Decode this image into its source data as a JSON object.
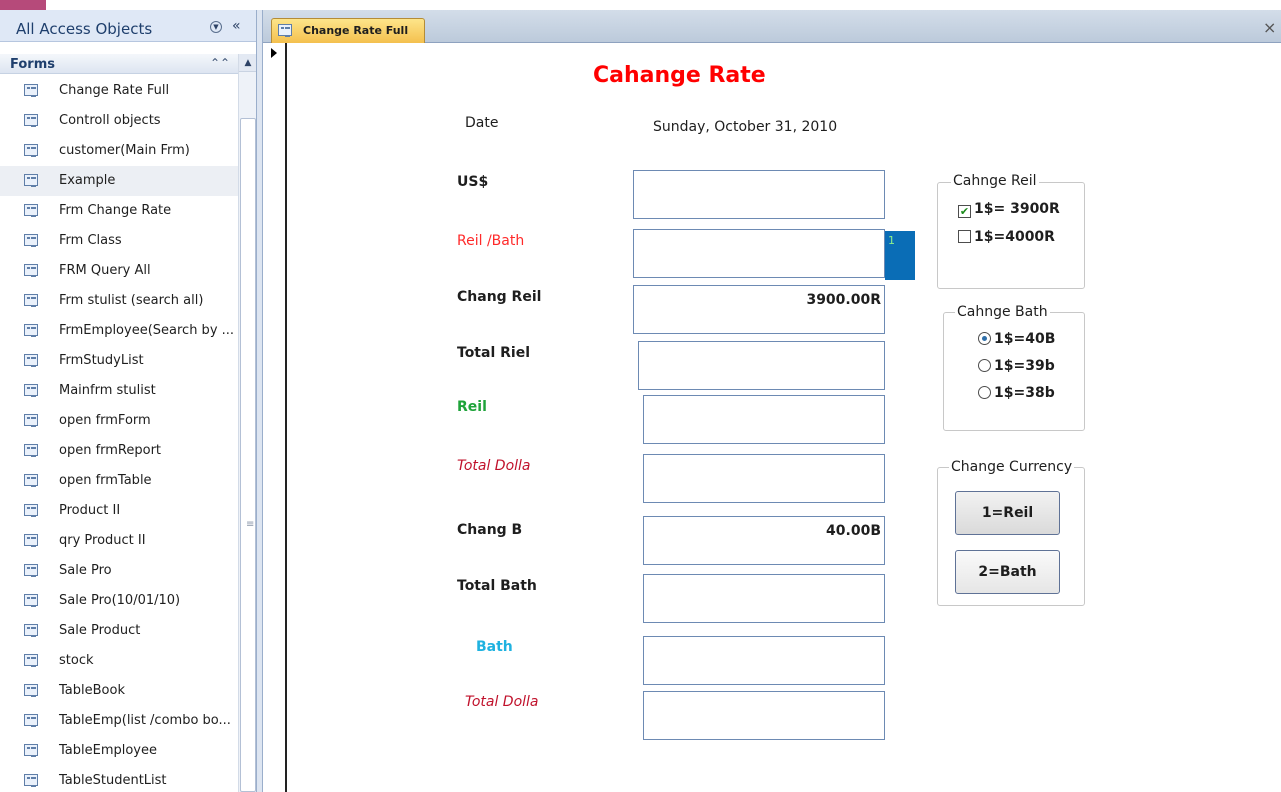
{
  "nav": {
    "title": "All Access Objects",
    "group_label": "Forms",
    "items": [
      {
        "label": "Change Rate Full"
      },
      {
        "label": "Controll objects"
      },
      {
        "label": "customer(Main Frm)"
      },
      {
        "label": "Example",
        "selected": true
      },
      {
        "label": "Frm Change Rate"
      },
      {
        "label": "Frm Class"
      },
      {
        "label": "FRM Query All"
      },
      {
        "label": "Frm stulist (search all)"
      },
      {
        "label": "FrmEmployee(Search  by ..."
      },
      {
        "label": "FrmStudyList"
      },
      {
        "label": "Mainfrm stulist"
      },
      {
        "label": "open frmForm"
      },
      {
        "label": "open frmReport"
      },
      {
        "label": "open frmTable"
      },
      {
        "label": "Product II"
      },
      {
        "label": "qry Product II"
      },
      {
        "label": "Sale Pro"
      },
      {
        "label": "Sale Pro(10/01/10)"
      },
      {
        "label": "Sale Product"
      },
      {
        "label": "stock"
      },
      {
        "label": "TableBook"
      },
      {
        "label": "TableEmp(list /combo bo..."
      },
      {
        "label": "TableEmployee"
      },
      {
        "label": "TableStudentList"
      }
    ]
  },
  "document_tab": {
    "label": "Change Rate Full"
  },
  "form": {
    "title": "Cahange Rate",
    "date_label": "Date",
    "date_value": "Sunday, October 31, 2010",
    "fields": {
      "usd": {
        "label": "US$",
        "value": ""
      },
      "reil_bath": {
        "label": "Reil /Bath",
        "value": ""
      },
      "chang_reil": {
        "label": "Chang Reil",
        "value": "3900.00R"
      },
      "total_riel": {
        "label": "Total Riel",
        "value": ""
      },
      "reil": {
        "label": "Reil",
        "value": ""
      },
      "total_dolla_1": {
        "label": "Total Dolla",
        "value": ""
      },
      "chang_b": {
        "label": "Chang B",
        "value": "40.00B"
      },
      "total_bath": {
        "label": "Total Bath",
        "value": ""
      },
      "bath": {
        "label": "Bath",
        "value": ""
      },
      "total_dolla_2": {
        "label": "Total Dolla",
        "value": ""
      }
    },
    "blue_cell_text": "1",
    "frame_reil": {
      "caption": "Cahnge Reil",
      "options": [
        {
          "label": "1$= 3900R",
          "checked": true
        },
        {
          "label": "1$=4000R",
          "checked": false
        }
      ]
    },
    "frame_bath": {
      "caption": "Cahnge Bath",
      "options": [
        {
          "label": "1$=40B",
          "selected": true
        },
        {
          "label": "1$=39b",
          "selected": false
        },
        {
          "label": "1$=38b",
          "selected": false
        }
      ]
    },
    "frame_currency": {
      "caption": "Change Currency",
      "buttons": [
        {
          "label": "1=Reil"
        },
        {
          "label": "2=Bath"
        }
      ]
    }
  },
  "colors": {
    "title_red": "#ff0000",
    "label_red": "#ff2a2a",
    "label_green": "#1ea33a",
    "label_darkred": "#c0112b",
    "label_cyan": "#1fb2e0",
    "blue_cell": "#0a6db6"
  },
  "icons": {
    "form_object": "form-icon",
    "dropdown": "chevron-down-circle-icon",
    "collapse": "double-chevron-left-icon",
    "group_toggle": "double-chevron-up-icon",
    "close": "close-icon",
    "record_selector": "record-arrow-icon"
  }
}
